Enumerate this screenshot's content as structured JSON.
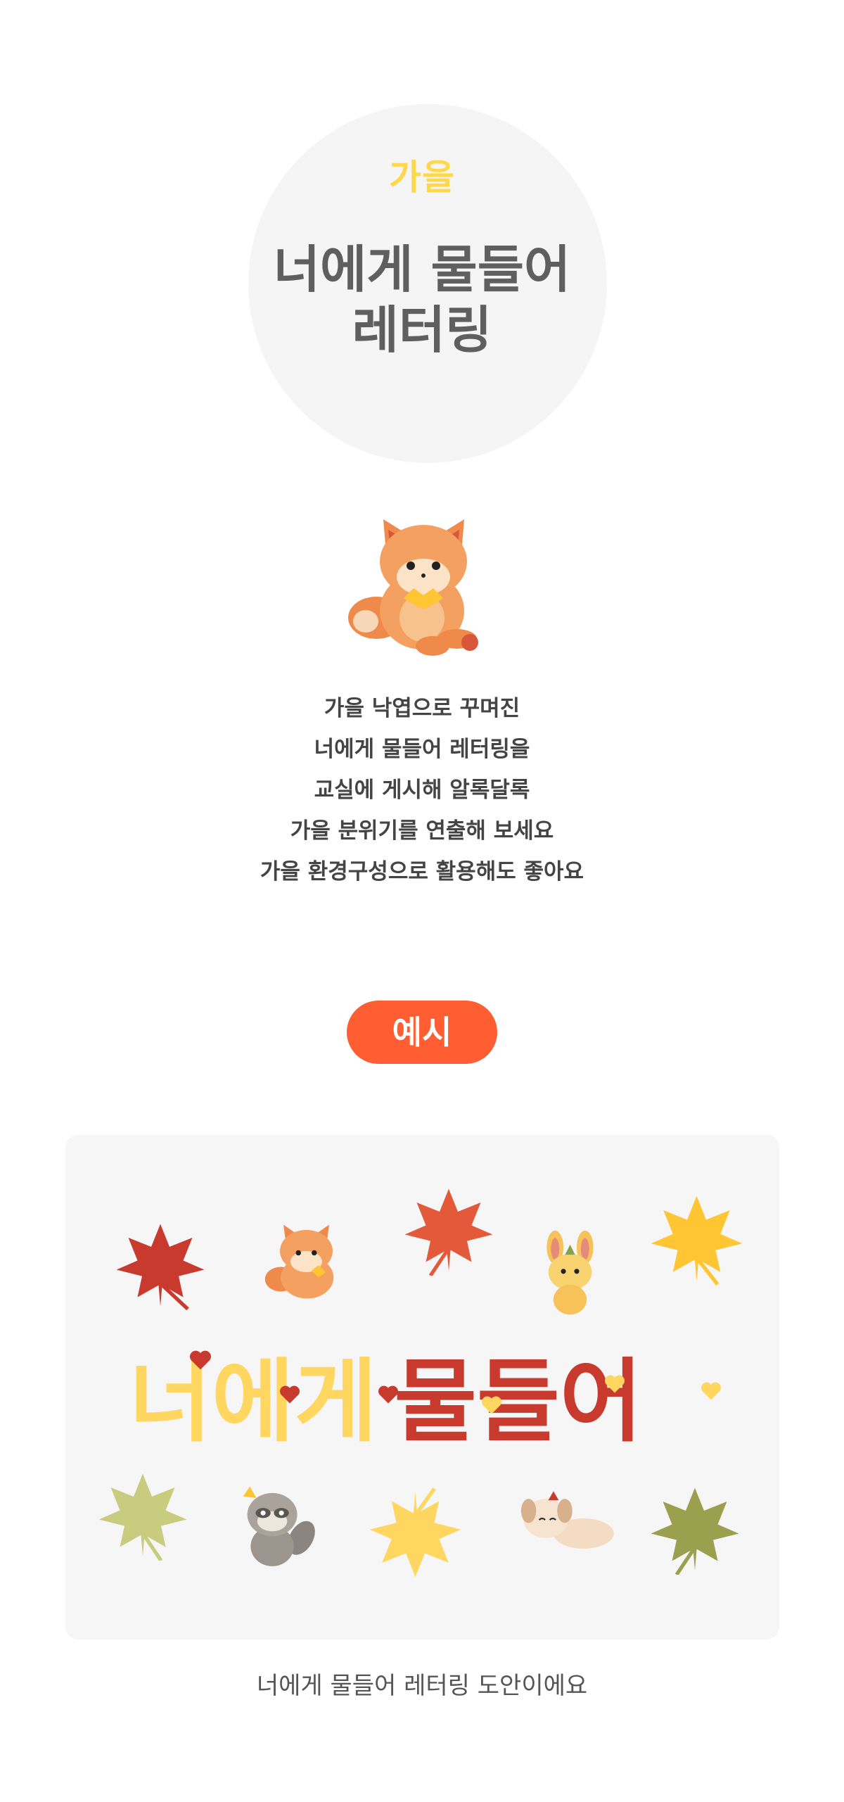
{
  "hero": {
    "kicker": "가을",
    "title_line1": "너에게 물들어",
    "title_line2": "레터링"
  },
  "description": [
    "가을 낙엽으로 꾸며진",
    "너에게 물들어 레터링을",
    "교실에 게시해 알록달록",
    "가을 분위기를 연출해 보세요",
    "가을 환경구성으로 활용해도 좋아요"
  ],
  "badge": {
    "label": "예시"
  },
  "example": {
    "lettering_part1": "너에게",
    "lettering_part2": "물들어"
  },
  "caption": "너에게 물들어 레터링 도안이에요",
  "colors": {
    "accent": "#ff5e32",
    "yellow": "#ffd84a",
    "red": "#c83a2e",
    "title_gray": "#5f5f5f"
  }
}
